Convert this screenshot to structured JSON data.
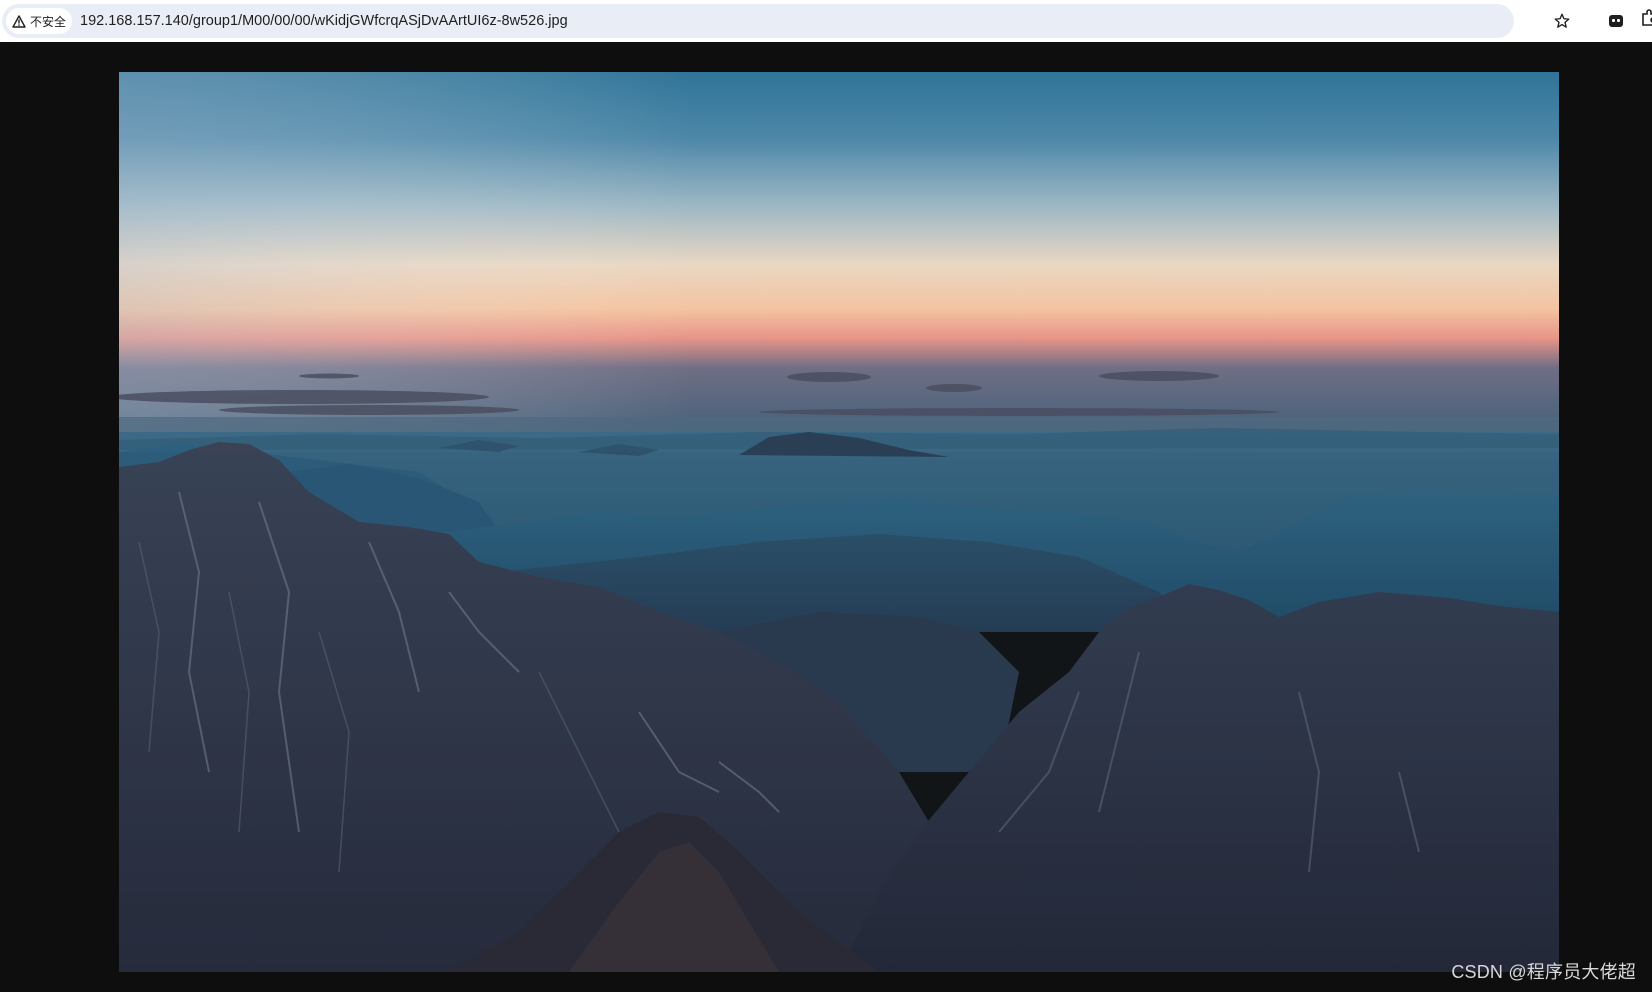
{
  "browser": {
    "security_label": "不安全",
    "url": "192.168.157.140/group1/M00/00/00/wKidjGWfcrqASjDvAArtUI6z-8w526.jpg",
    "icons": [
      "warning-icon",
      "star-icon",
      "extension-icon",
      "puzzle-icon"
    ]
  },
  "image": {
    "description_icon": "mountain-landscape-photo",
    "colors": {
      "sky_top": "#2f7498",
      "horizon_warm": "#f2c9a6",
      "horizon_pink": "#e88a80",
      "mist": "#2d5d78",
      "mountains_dark": "#2b2d3e"
    }
  },
  "watermark": "CSDN @程序员大佬超"
}
